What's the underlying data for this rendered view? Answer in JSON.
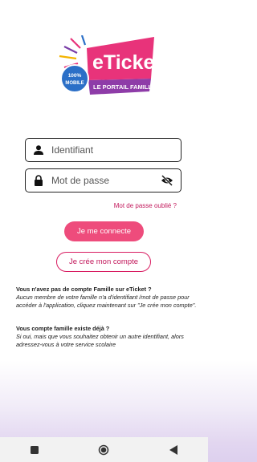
{
  "logo": {
    "brand": "eTicket",
    "badge_line1": "100%",
    "badge_line2": "MOBILE",
    "tagline": "LE PORTAIL FAMILLE"
  },
  "login": {
    "placeholder": "Identifiant",
    "icon": "person-icon"
  },
  "password": {
    "placeholder": "Mot de passe",
    "icon": "lock-icon",
    "toggle_icon": "eye-off-icon"
  },
  "forgot_link": "Mot de passe oublié ?",
  "connect_button": "Je me connecte",
  "create_button": "Je crée mon compte",
  "info": [
    {
      "heading": "Vous n'avez pas de compte Famille sur eTicket ?",
      "body": "Aucun membre de votre famille n'a d'identifiant /mot de passe pour accéder à l'application, cliquez maintenant sur \"Je crée mon compte\"."
    },
    {
      "heading": "Vous compte famille existe déjà ?",
      "body": "Si oui, mais que vous souhaitez obtenir un autre identifiant, alors adressez-vous à votre service scolaire"
    }
  ],
  "colors": {
    "accent": "#ee4c7c",
    "link": "#c2185b",
    "logo_pink": "#e8337a",
    "logo_purple": "#8e3ca8",
    "badge_blue": "#2b6fc7"
  },
  "navbar": {
    "icons": [
      "recents-icon",
      "home-icon",
      "back-icon"
    ]
  }
}
